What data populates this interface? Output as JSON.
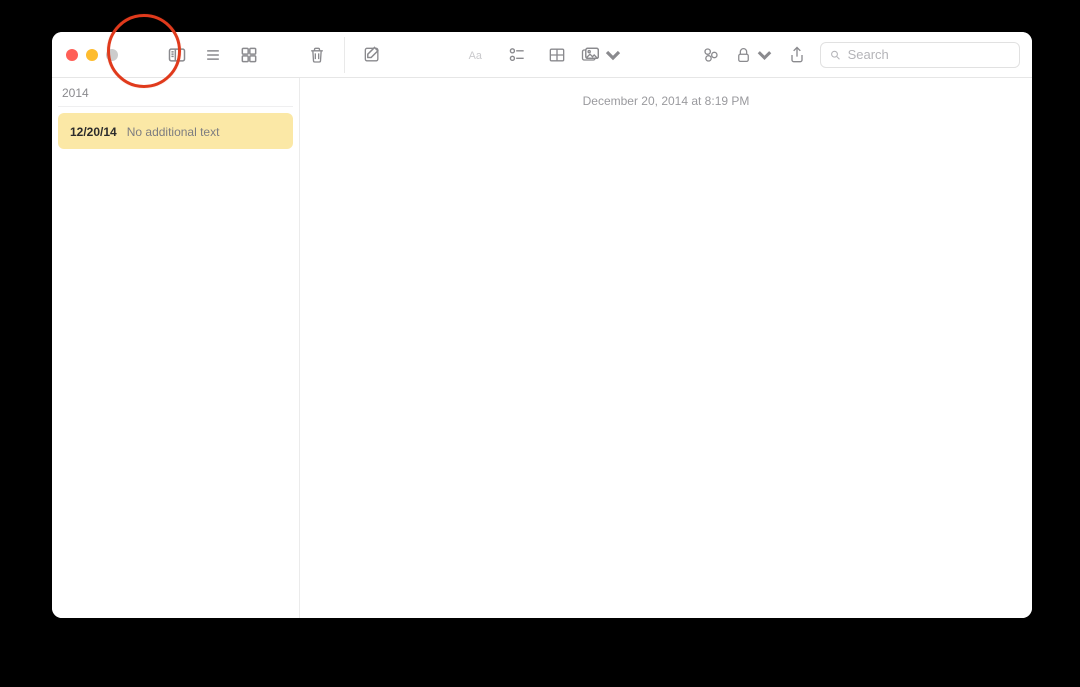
{
  "toolbar": {
    "search_placeholder": "Search"
  },
  "sidebar": {
    "section_header": "2014",
    "notes": [
      {
        "title_glyph": "",
        "date": "12/20/14",
        "subtitle": "No additional text"
      }
    ]
  },
  "editor": {
    "timestamp": "December 20, 2014 at 8:19 PM",
    "body_glyph": ""
  }
}
